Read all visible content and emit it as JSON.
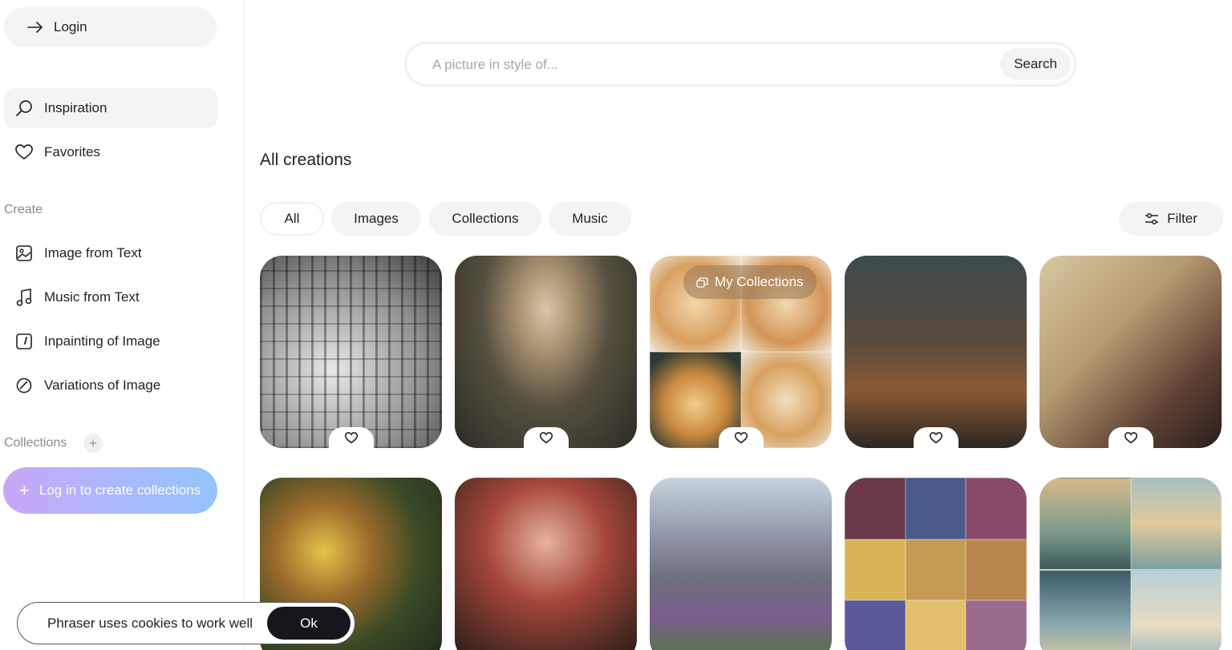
{
  "sidebar": {
    "login_label": "Login",
    "nav": [
      {
        "label": "Inspiration",
        "icon": "search-icon",
        "active": true
      },
      {
        "label": "Favorites",
        "icon": "heart-icon",
        "active": false
      }
    ],
    "create_label": "Create",
    "create_items": [
      {
        "label": "Image from Text",
        "icon": "image-icon"
      },
      {
        "label": "Music from Text",
        "icon": "music-note-icon"
      },
      {
        "label": "Inpainting of Image",
        "icon": "inpainting-icon"
      },
      {
        "label": "Variations of Image",
        "icon": "variations-icon"
      }
    ],
    "collections_label": "Collections",
    "collections_add": "+",
    "login_collections_label": "Log in to create collections"
  },
  "search": {
    "placeholder": "A picture in style of...",
    "value": "",
    "button_label": "Search"
  },
  "main": {
    "heading": "All creations",
    "tabs": [
      "All",
      "Images",
      "Collections",
      "Music"
    ],
    "filter_label": "Filter",
    "collection_badge": "My Collections"
  },
  "cookie": {
    "text": "Phraser uses cookies to work well",
    "ok_label": "Ok"
  },
  "colors": {
    "accent_gradient_start": "#c9a6f7",
    "accent_gradient_end": "#94c4fb",
    "pill_bg": "#f4f4f5",
    "cookie_button": "#15171c"
  }
}
